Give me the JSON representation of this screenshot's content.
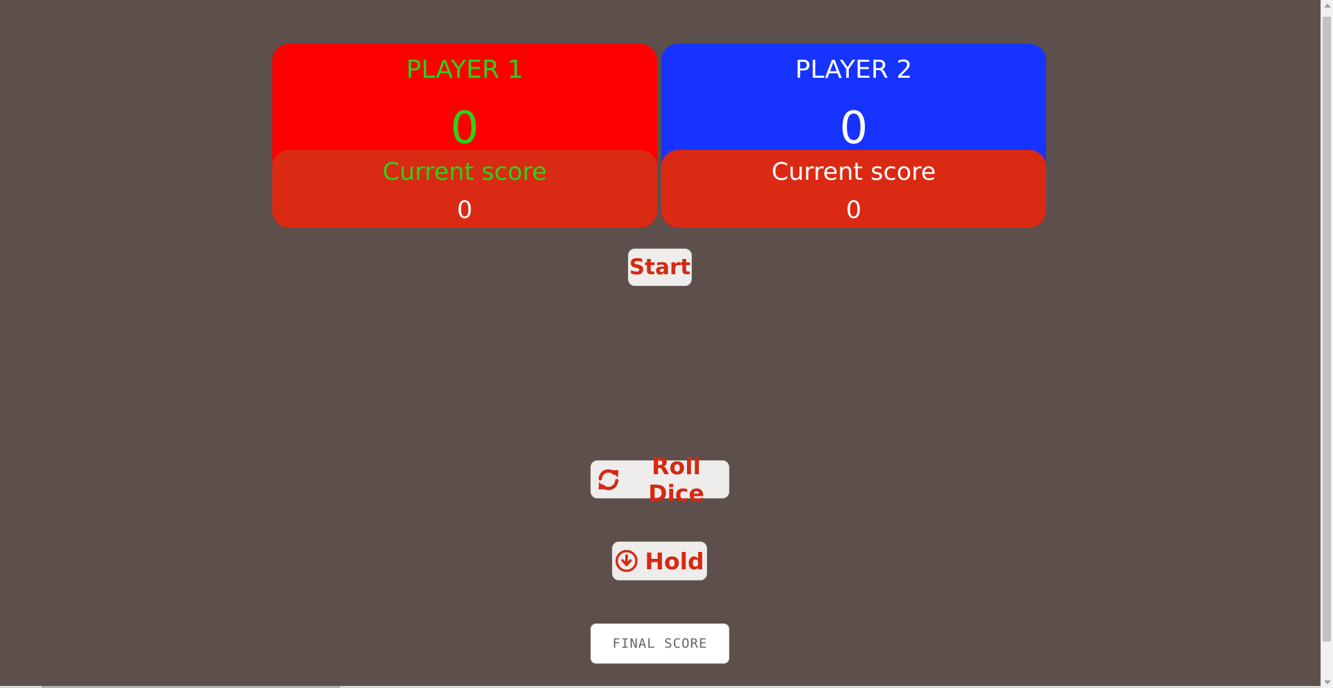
{
  "players": [
    {
      "name": "PLAYER 1",
      "total_score": "0",
      "current_label": "Current score",
      "current_score": "0",
      "panel_color": "#ff0000",
      "text_color": "#2bd21c"
    },
    {
      "name": "PLAYER 2",
      "total_score": "0",
      "current_label": "Current score",
      "current_score": "0",
      "panel_color": "#1733ff",
      "text_color": "#ffffff"
    }
  ],
  "controls": {
    "start_label": "Start",
    "roll_label": "Roll Dice",
    "roll_icon": "refresh-icon",
    "hold_label": "Hold",
    "hold_icon": "arrow-down-circle-icon",
    "final_score_placeholder": "FINAL SCORE"
  },
  "colors": {
    "background": "#5c4f4c",
    "current_box": "#da2a14",
    "button_text": "#d52914",
    "button_bg": "#efedeb"
  }
}
